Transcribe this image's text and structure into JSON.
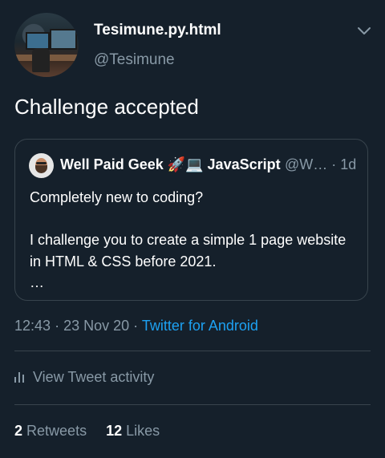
{
  "header": {
    "display_name": "Tesimune.py.html",
    "handle": "@Tesimune"
  },
  "tweet": {
    "text": "Challenge accepted"
  },
  "quote": {
    "author_name": "Well Paid Geek 🚀💻 JavaScript",
    "author_handle": "@W…",
    "separator": "·",
    "time_ago": "1d",
    "body": "Completely new to coding?\n\nI challenge you to create a simple 1 page website in HTML & CSS before 2021.\n…"
  },
  "meta": {
    "time": "12:43",
    "date": "23 Nov 20",
    "source": "Twitter for Android"
  },
  "activity": {
    "label": "View Tweet activity"
  },
  "stats": {
    "retweets_count": "2",
    "retweets_label": "Retweets",
    "likes_count": "12",
    "likes_label": "Likes"
  },
  "colors": {
    "background": "#15202b",
    "secondary_text": "#8899a6",
    "link": "#1da1f2",
    "border": "#38444d"
  }
}
